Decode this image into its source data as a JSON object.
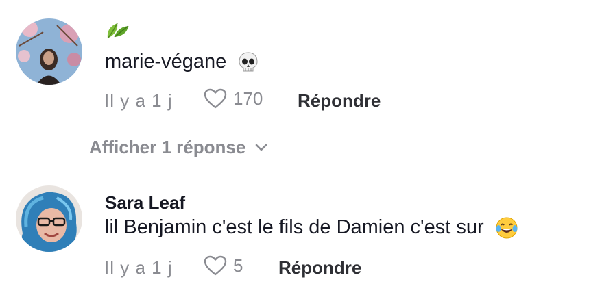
{
  "comments": [
    {
      "username": "marie-végane",
      "username_badge_icon": "leaf-icon",
      "text_emoji_icon": "skull-icon",
      "time": "Il y a 1 j",
      "likes": "170",
      "reply_label": "Répondre",
      "view_replies_label": "Afficher 1 réponse"
    },
    {
      "username": "Sara Leaf",
      "text": "lil Benjamin c'est le fils de Damien c'est sur",
      "text_emoji_icon": "laughing-tears-icon",
      "time": "Il y a 1 j",
      "likes": "5",
      "reply_label": "Répondre"
    }
  ],
  "colors": {
    "primary_text": "#161823",
    "secondary_text": "#8a8b91",
    "reply_text": "#2f3035"
  }
}
